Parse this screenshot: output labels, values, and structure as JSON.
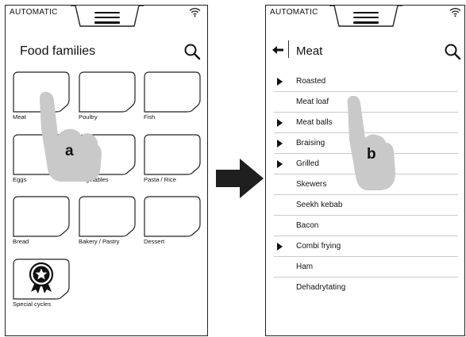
{
  "status_text": "AUTOMATIC",
  "screen_a": {
    "title": "Food families",
    "tiles": [
      {
        "label": "Meat"
      },
      {
        "label": "Poultry"
      },
      {
        "label": "Fish"
      },
      {
        "label": "Eggs"
      },
      {
        "label": "Vegetables"
      },
      {
        "label": "Pasta / Rice"
      },
      {
        "label": "Bread"
      },
      {
        "label": "Bakery / Pastry"
      },
      {
        "label": "Dessert"
      },
      {
        "label": "Special cycles",
        "icon": "ribbon-star-icon"
      }
    ],
    "callout": "a"
  },
  "screen_b": {
    "title": "Meat",
    "items": [
      {
        "label": "Roasted",
        "expandable": true
      },
      {
        "label": "Meat loaf",
        "expandable": false
      },
      {
        "label": "Meat balls",
        "expandable": true
      },
      {
        "label": "Braising",
        "expandable": true
      },
      {
        "label": "Grilled",
        "expandable": true
      },
      {
        "label": "Skewers",
        "expandable": false
      },
      {
        "label": "Seekh kebab",
        "expandable": false
      },
      {
        "label": "Bacon",
        "expandable": false
      },
      {
        "label": "Combi frying",
        "expandable": true
      },
      {
        "label": "Ham",
        "expandable": false
      },
      {
        "label": "Dehadrytating",
        "expandable": false
      }
    ],
    "callout": "b"
  },
  "colors": {
    "hand": "#c9c9c9",
    "arrow": "#1f1f1f",
    "outline": "#222222"
  }
}
